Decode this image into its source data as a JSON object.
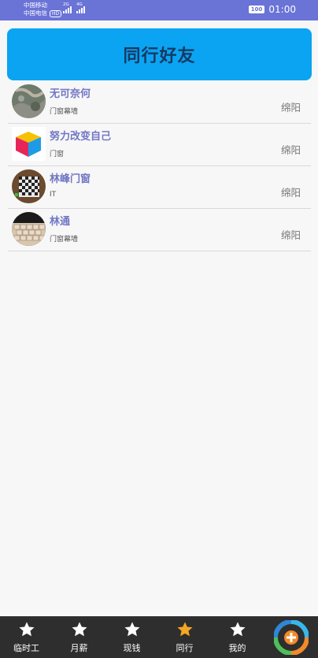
{
  "status_bar": {
    "carrier1": "中国移动",
    "carrier2": "中国电信",
    "hd": "HD",
    "net1": "2G",
    "net2": "4G",
    "battery": "100",
    "time": "01:00"
  },
  "header": {
    "title": "同行好友"
  },
  "friends": [
    {
      "name": "无可奈何",
      "trade": "门窗幕墙",
      "city": "绵阳"
    },
    {
      "name": "努力改变自己",
      "trade": "门窗",
      "city": "绵阳"
    },
    {
      "name": "林峰门窗",
      "trade": "IT",
      "city": "绵阳"
    },
    {
      "name": "林通",
      "trade": "门窗幕墙",
      "city": "绵阳"
    }
  ],
  "nav": {
    "items": [
      {
        "label": "临时工",
        "icon": "star-icon",
        "active": false
      },
      {
        "label": "月薪",
        "icon": "star-icon",
        "active": false
      },
      {
        "label": "现钱",
        "icon": "star-icon",
        "active": false
      },
      {
        "label": "同行",
        "icon": "star-icon",
        "active": true
      },
      {
        "label": "我的",
        "icon": "star-icon",
        "active": false
      }
    ],
    "plus_icon": "add-circle-icon"
  },
  "colors": {
    "status_bar": "#6a73d6",
    "header_bg": "#0aa4f2",
    "header_text": "#173a63",
    "name_text": "#7177c4",
    "nav_bg": "#2e2e2e",
    "star_inactive": "#ffffff",
    "star_active": "#f5a623"
  }
}
